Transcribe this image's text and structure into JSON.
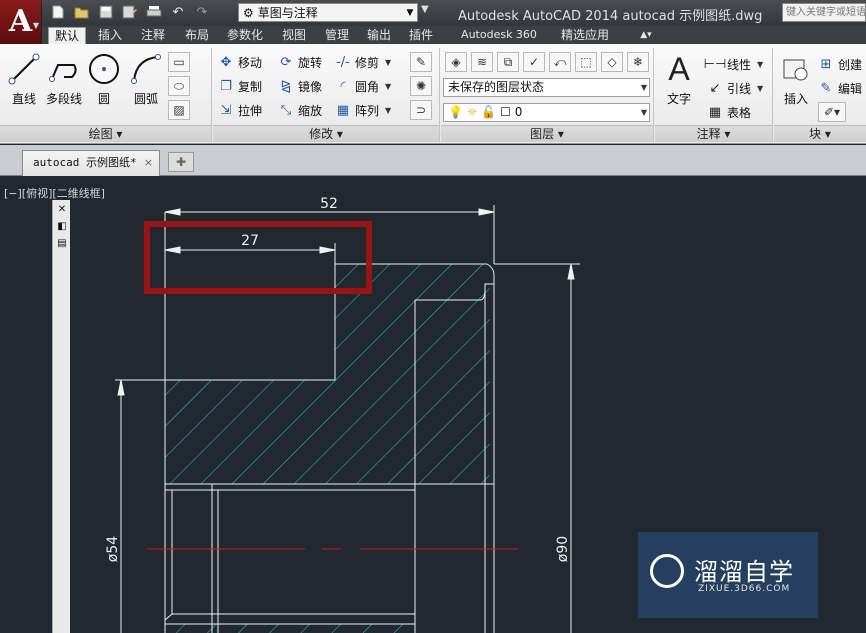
{
  "titlebar": {
    "app_logo": "A",
    "workspace": "草图与注释",
    "title": "Autodesk AutoCAD 2014    autocad 示例图纸.dwg",
    "search_placeholder": "键入关键字或短语",
    "qat_icons": [
      "new-icon",
      "open-icon",
      "save-icon",
      "saveas-icon",
      "print-icon",
      "undo-icon",
      "redo-icon"
    ]
  },
  "tabs": [
    "默认",
    "插入",
    "注释",
    "布局",
    "参数化",
    "视图",
    "管理",
    "输出",
    "插件",
    "Autodesk 360",
    "精选应用"
  ],
  "ribbon": {
    "draw": {
      "title": "绘图",
      "line": "直线",
      "polyline": "多段线",
      "circle": "圆",
      "arc": "圆弧"
    },
    "modify": {
      "title": "修改",
      "move": "移动",
      "rotate": "旋转",
      "trim": "修剪",
      "copy": "复制",
      "mirror": "镜像",
      "fillet": "圆角",
      "stretch": "拉伸",
      "scale": "缩放",
      "array": "阵列"
    },
    "layers": {
      "title": "图层",
      "state": "未保存的图层状态",
      "current": "0"
    },
    "annotation": {
      "title": "注释",
      "text": "文字",
      "linear": "线性",
      "leader": "引线",
      "table": "表格"
    },
    "block": {
      "title": "块",
      "insert": "插入",
      "create": "创建",
      "edit": "编辑"
    }
  },
  "document": {
    "tab_label": "autocad 示例图纸*"
  },
  "viewport": {
    "label": "[−][俯视][二维线框]"
  },
  "drawing": {
    "dims": {
      "top": "52",
      "highlight": "27",
      "left": "ø54",
      "right": "ø90"
    },
    "highlight_color": "#9b1414",
    "line_color": "#f0f0f0",
    "hatch_color": "#2ec9c9",
    "center_color": "#d01818"
  },
  "watermark": {
    "title": "溜溜自学",
    "url": "ZIXUE.3D66.COM"
  }
}
